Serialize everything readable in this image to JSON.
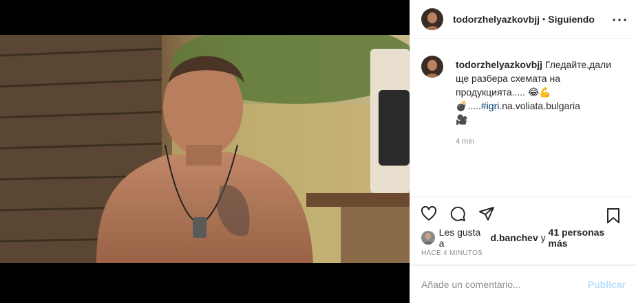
{
  "post": {
    "username": "todorzhelyazkovbjj",
    "separator": "•",
    "follow_status": "Siguiendo",
    "caption_user": "todorzhelyazkovbjj",
    "caption_text": "Гледайте,дали ще разбера схемата на продукцията.....",
    "caption_emojis": "😂💪💣",
    "caption_dots": ".....",
    "hashtag": "#igri",
    "caption_tail": ".na.voliata.bulgaria",
    "caption_end_emoji": "🎥",
    "time": "4 min",
    "likes_prefix": "Les gusta a",
    "likes_user": "d.banchev",
    "likes_conj": "y",
    "likes_others": "41 personas más",
    "posted_ago": "HACE 4 MINUTOS"
  },
  "icons": {
    "more": "more-options-icon",
    "like": "heart-icon",
    "comment": "comment-icon",
    "share": "share-icon",
    "save": "bookmark-icon"
  },
  "comment_box": {
    "placeholder": "Añade un comentario...",
    "publish_label": "Publicar"
  },
  "colors": {
    "link": "#00376b",
    "muted": "#8e8e8e",
    "publish_disabled": "#b9dffc"
  }
}
